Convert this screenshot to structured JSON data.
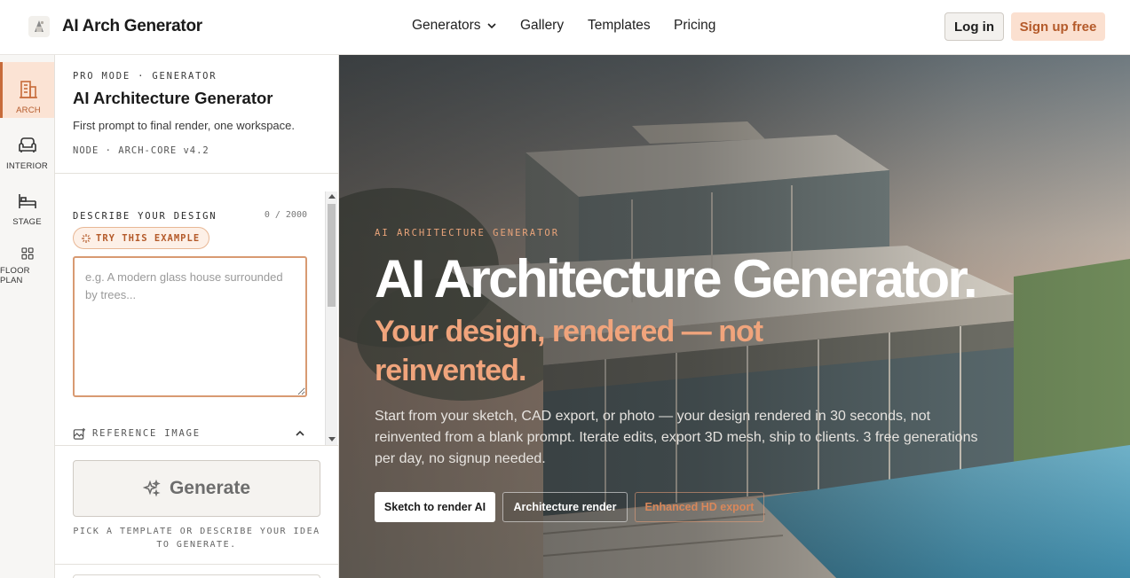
{
  "header": {
    "brand_name": "AI Arch Generator",
    "nav": {
      "generators": "Generators",
      "gallery": "Gallery",
      "templates": "Templates",
      "pricing": "Pricing"
    },
    "login": "Log in",
    "signup": "Sign up free"
  },
  "rail": {
    "items": [
      {
        "label": "ARCH",
        "icon": "building-icon",
        "active": true
      },
      {
        "label": "INTERIOR",
        "icon": "armchair-icon",
        "active": false
      },
      {
        "label": "STAGE",
        "icon": "bed-icon",
        "active": false
      },
      {
        "label": "FLOOR PLAN",
        "icon": "grid-icon",
        "active": false
      }
    ]
  },
  "panel": {
    "kicker": "PRO MODE · GENERATOR",
    "title": "AI Architecture Generator",
    "subtitle": "First prompt to final render, one workspace.",
    "node": "NODE · ARCH-CORE v4.2",
    "describe_label": "DESCRIBE YOUR DESIGN",
    "char_count": "0 / 2000",
    "try_example": "TRY THIS EXAMPLE",
    "prompt_placeholder": "e.g. A modern glass house surrounded by trees...",
    "prompt_value": "",
    "reference_label": "REFERENCE IMAGE",
    "generate_label": "Generate",
    "generate_hint": "PICK A TEMPLATE OR DESCRIBE YOUR IDEA TO GENERATE."
  },
  "hero": {
    "kicker": "AI ARCHITECTURE GENERATOR",
    "title": "AI Architecture Generator.",
    "tagline": "Your design, rendered — not reinvented.",
    "body": "Start from your sketch, CAD export, or photo — your design rendered in 30 seconds, not reinvented from a blank prompt. Iterate edits, export 3D mesh, ship to clients. 3 free generations per day, no signup needed.",
    "buttons": {
      "sketch": "Sketch to render AI",
      "render": "Architecture render",
      "hd": "Enhanced HD export"
    }
  },
  "colors": {
    "accent": "#c76b3a",
    "accent_soft": "#fbe3d4",
    "tagline": "#f0a47c"
  }
}
